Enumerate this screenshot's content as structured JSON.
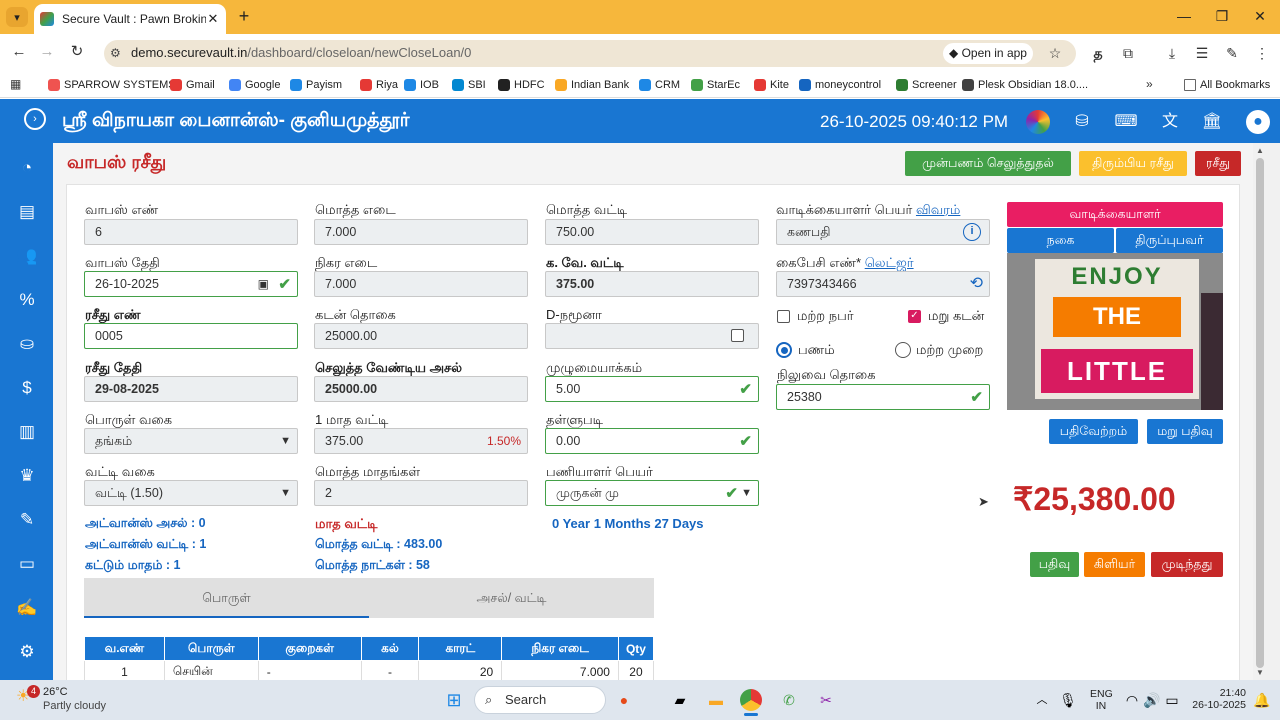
{
  "browser": {
    "tab_title": "Secure Vault : Pawn Broking Exp",
    "url_host": "demo.securevault.in",
    "url_path": "/dashboard/closeloan/newCloseLoan/0",
    "open_in_app": "Open in app",
    "bookmarks": [
      "SPARROW SYSTEMS",
      "Gmail",
      "Google",
      "Payism",
      "Riya",
      "IOB",
      "SBI",
      "HDFC",
      "Indian Bank",
      "CRM",
      "StarEc",
      "Kite",
      "moneycontrol",
      "Screener",
      "Plesk Obsidian 18.0...."
    ],
    "all_bookmarks": "All Bookmarks",
    "profile_glyph": "த"
  },
  "header": {
    "title": "ஸ்ரீ விநாயகா பைனான்ஸ்- குனியமுத்தூர்",
    "datetime": "26-10-2025 09:40:12 PM"
  },
  "page": {
    "title": "வாபஸ் ரசீது",
    "top_buttons": [
      "முன்பணம் செலுத்துதல்",
      "திரும்பிய ரசீது",
      "ரசீது"
    ]
  },
  "form": {
    "col1": [
      {
        "label": "வாபஸ் எண்",
        "value": "6"
      },
      {
        "label": "வாபஸ் தேதி",
        "value": "26-10-2025"
      },
      {
        "label": "ரசீது எண்",
        "value": "0005"
      },
      {
        "label": "ரசீது தேதி",
        "value": "29-08-2025"
      },
      {
        "label": "பொருள் வகை",
        "value": "தங்கம்"
      },
      {
        "label": "வட்டி வகை",
        "value": "வட்டி (1.50)"
      }
    ],
    "col2": [
      {
        "label": "மொத்த எடை",
        "value": "7.000"
      },
      {
        "label": "நிகர எடை",
        "value": "7.000"
      },
      {
        "label": "கடன் தொகை",
        "value": "25000.00"
      },
      {
        "label": "செலுத்த வேண்டிய அசல்",
        "value": "25000.00"
      },
      {
        "label": "1 மாத வட்டி",
        "value": "375.00",
        "extra": "1.50%"
      },
      {
        "label": "மொத்த மாதங்கள்",
        "value": "2"
      }
    ],
    "col3": [
      {
        "label": "மொத்த வட்டி",
        "value": "750.00"
      },
      {
        "label": "க. வே. வட்டி",
        "value": "375.00"
      },
      {
        "label": "D-நமூனா",
        "value": ""
      },
      {
        "label": "முழுமையாக்கம்",
        "value": "5.00"
      },
      {
        "label": "தள்ளுபடி",
        "value": "0.00"
      },
      {
        "label": "பணியாளர் பெயர்",
        "value": "முருகன் மு"
      }
    ],
    "col4": {
      "customer_label": "வாடிக்கையாளர் பெயர்",
      "customer_link": "விவரம்",
      "customer_value": "கணபதி",
      "phone_label": "கைபேசி எண்*",
      "phone_link": "லெட்ஜர்",
      "phone_value": "7397343466",
      "other_person": "மற்ற நபர்",
      "re_loan": "மறு கடன்",
      "cash": "பணம்",
      "other_mode": "மற்ற முறை",
      "balance_label": "நிலுவை தொகை",
      "balance_value": "25380"
    }
  },
  "summary": {
    "advance_principal": "அட்வான்ஸ் அசல் : 0",
    "advance_interest": "அட்வான்ஸ் வட்டி : 1",
    "months_paid": "கட்டும் மாதம் : 1",
    "monthly_interest": "மாத வட்டி",
    "total_interest": "மொத்த வட்டி : 483.00",
    "total_days": "மொத்த நாட்கள் : 58",
    "duration": "0 Year 1 Months 27 Days"
  },
  "side": {
    "tabs": [
      "வாடிக்கையாளர்",
      "நகை",
      "திருப்புபவர்"
    ],
    "photo_text": [
      "ENJOY",
      "THE",
      "LITTLE"
    ],
    "buttons": [
      "பதிவேற்றம்",
      "மறு பதிவு"
    ],
    "amount": "₹25,380.00",
    "actions": [
      "பதிவு",
      "கிளியர்",
      "முடிந்தது"
    ]
  },
  "tabs": [
    "பொருள்",
    "அசல்/ வட்டி"
  ],
  "table": {
    "headers": [
      "வ.எண்",
      "பொருள்",
      "குறைகள்",
      "கல்",
      "காரட்",
      "நிகர எடை",
      "Qty"
    ],
    "rows": [
      [
        "1",
        "செயின்",
        "-",
        "-",
        "20",
        "7.000",
        "20"
      ]
    ]
  },
  "taskbar": {
    "temp": "26°C",
    "weather": "Partly cloudy",
    "search": "Search",
    "lang1": "ENG",
    "lang2": "IN",
    "time": "21:40",
    "date": "26-10-2025",
    "badge": "4"
  },
  "colors": {
    "primary": "#1976d2",
    "success": "#43a047",
    "warning": "#fbc02d",
    "danger": "#c62828",
    "pink": "#e91e63",
    "orange": "#f57c00"
  }
}
